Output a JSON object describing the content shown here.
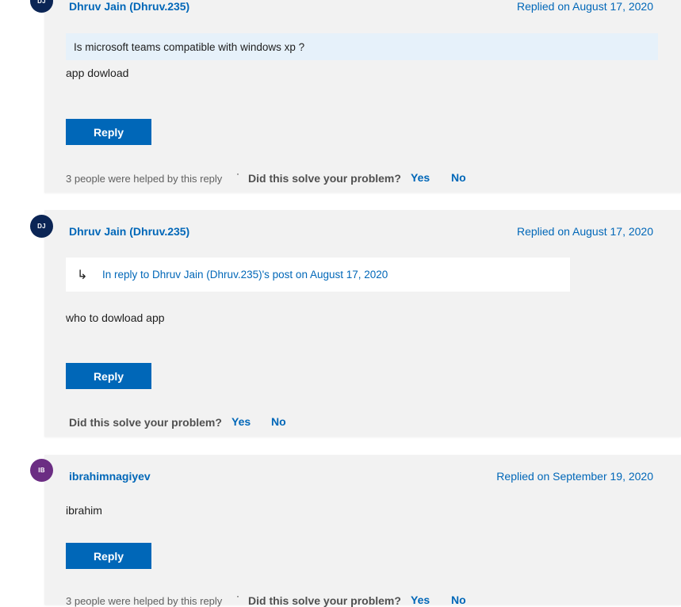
{
  "posts": [
    {
      "avatar_initials": "DJ",
      "avatar_color": "#0b2555",
      "author": "Dhruv Jain (Dhruv.235)",
      "date": "Replied on August 17, 2020",
      "quote": "Is microsoft teams compatible with windows xp ?",
      "body": "app dowload",
      "reply_label": "Reply",
      "helped_text": "3 people were helped by this reply",
      "question": "Did this solve your problem?",
      "yes_label": "Yes",
      "no_label": "No"
    },
    {
      "avatar_initials": "DJ",
      "avatar_color": "#0b2555",
      "author": "Dhruv Jain (Dhruv.235)",
      "date": "Replied on August 17, 2020",
      "in_reply_to": "In reply to Dhruv Jain (Dhruv.235)'s post on August 17, 2020",
      "in_reply_icon": "reply-arrow-icon",
      "body": "who to dowload app",
      "reply_label": "Reply",
      "question": "Did this solve your problem?",
      "yes_label": "Yes",
      "no_label": "No"
    },
    {
      "avatar_initials": "IB",
      "avatar_color": "#6b2d83",
      "author": "ibrahimnagiyev",
      "date": "Replied on September 19, 2020",
      "body": "ibrahim",
      "reply_label": "Reply",
      "helped_text": "3 people were helped by this reply",
      "question": "Did this solve your problem?",
      "yes_label": "Yes",
      "no_label": "No"
    }
  ]
}
